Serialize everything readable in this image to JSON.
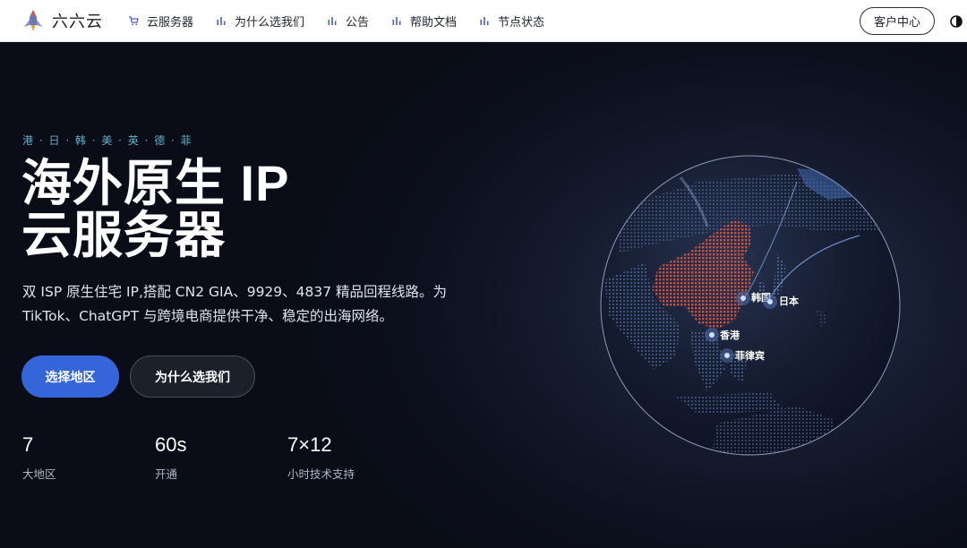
{
  "brand": {
    "name": "六六云",
    "logo_icon": "rocket-logo-icon"
  },
  "nav": {
    "items": [
      {
        "label": "云服务器",
        "icon": "cart-icon"
      },
      {
        "label": "为什么选我们",
        "icon": "bar-chart-icon"
      },
      {
        "label": "公告",
        "icon": "bar-chart-icon"
      },
      {
        "label": "帮助文档",
        "icon": "bar-chart-icon"
      },
      {
        "label": "节点状态",
        "icon": "bar-chart-icon"
      }
    ],
    "client_center": "客户中心",
    "theme_toggle_icon": "contrast-icon"
  },
  "hero": {
    "eyebrow": "港 · 日 · 韩 · 美 · 英 · 德 · 菲",
    "title_line1": "海外原生 IP",
    "title_line2": "云服务器",
    "subtitle": "双 ISP 原生住宅 IP,搭配 CN2 GIA、9929、4837 精品回程线路。为 TikTok、ChatGPT 与跨境电商提供干净、稳定的出海网络。",
    "primary_button": "选择地区",
    "secondary_button": "为什么选我们",
    "stats": [
      {
        "value": "7",
        "label": "大地区"
      },
      {
        "value": "60s",
        "label": "开通"
      },
      {
        "value": "7×12",
        "label": "小时技术支持"
      }
    ]
  },
  "globe": {
    "nodes": [
      "韩国",
      "日本",
      "香港",
      "菲律宾"
    ]
  },
  "colors": {
    "accent": "#3566d9",
    "eyebrow": "#5fb0c4",
    "china_highlight": "#c9594f",
    "globe_dots": "#5b7bb0",
    "hero_bg": "#0c0f1c"
  }
}
